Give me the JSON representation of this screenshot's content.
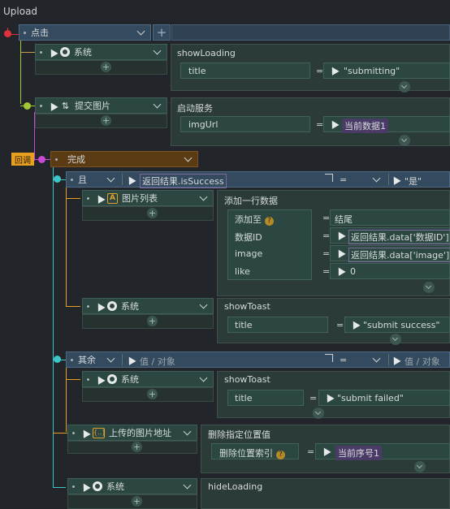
{
  "app": {
    "title": "Upload"
  },
  "colors": {
    "accent_red": "#e0323c",
    "accent_lime": "#a0c832",
    "accent_magenta": "#c84ad2",
    "accent_cyan": "#3cc8c8",
    "accent_orange": "#e8a020",
    "accent_purple": "#4a3a66"
  },
  "root": {
    "event": "点击"
  },
  "blocks": {
    "sys1": {
      "module": "系统",
      "method": "showLoading",
      "params": [
        {
          "name": "title",
          "eq": "=",
          "value": "\"submitting\""
        }
      ]
    },
    "submit": {
      "module": "提交图片",
      "method": "启动服务",
      "params": [
        {
          "name": "imgUrl",
          "eq": "=",
          "value": "当前数据1"
        }
      ]
    },
    "callback": {
      "badge": "回调",
      "event": "完成"
    },
    "cond_if": {
      "keyword": "且",
      "condition": "返回结果.isSuccess",
      "eq": "=",
      "value": "\"是\""
    },
    "imglist": {
      "module": "图片列表",
      "method": "添加一行数据",
      "params": [
        {
          "name": "添加至",
          "help": "?",
          "eq": "=",
          "value": "结尾"
        },
        {
          "name": "数据ID",
          "eq": "=",
          "value": "返回结果.data['数据ID']"
        },
        {
          "name": "image",
          "eq": "=",
          "value": "返回结果.data['image']"
        },
        {
          "name": "like",
          "eq": "=",
          "value": "0"
        }
      ]
    },
    "sys2": {
      "module": "系统",
      "method": "showToast",
      "params": [
        {
          "name": "title",
          "eq": "=",
          "value": "\"submit success\""
        }
      ]
    },
    "cond_else": {
      "keyword": "其余",
      "placeholder": "值 / 对象",
      "eq": "=",
      "placeholder2": "值 / 对象"
    },
    "sys3": {
      "module": "系统",
      "method": "showToast",
      "params": [
        {
          "name": "title",
          "eq": "=",
          "value": "\"submit failed\""
        }
      ]
    },
    "uploaded": {
      "module": "上传的图片地址",
      "method": "删除指定位置值",
      "params": [
        {
          "name": "删除位置索引",
          "help": "?",
          "eq": "=",
          "value": "当前序号1"
        }
      ]
    },
    "sys4": {
      "module": "系统",
      "method": "hideLoading"
    }
  },
  "icons": {
    "cursor": "pointer-icon",
    "gear": "gear-icon",
    "plus": "plus-icon",
    "chevron": "chevron-down-icon",
    "expand": "expand-icon"
  }
}
